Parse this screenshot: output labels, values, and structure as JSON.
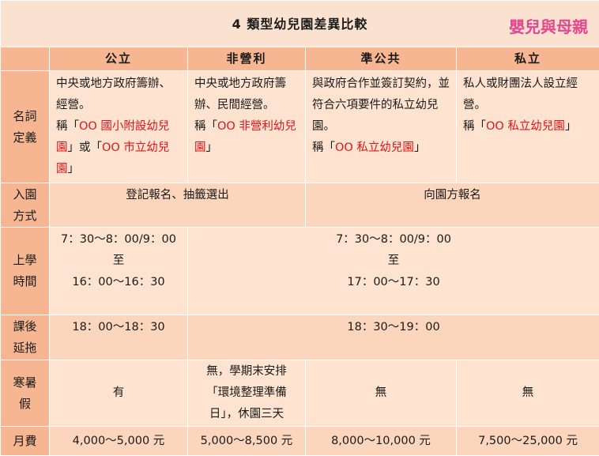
{
  "title": "4 類型幼兒園差異比較",
  "logo_text": "嬰兒與母親",
  "columns": [
    "公立",
    "非營利",
    "準公共",
    "私立"
  ],
  "definition": {
    "label_lines": [
      "名詞",
      "定義"
    ],
    "public": {
      "text": "中央或地方政府籌辦、經營。",
      "prefix": "稱「",
      "red1": "OO 國小附設幼兒園",
      "mid": "」或「",
      "red2": "OO 市立幼兒園",
      "suffix": "」"
    },
    "nonprofit": {
      "text": "中央或地方政府籌辦、民間經營。",
      "prefix": "稱「",
      "red": "OO 非營利幼兒園",
      "suffix": "」"
    },
    "quasi_public": {
      "text": "與政府合作並簽訂契約，並符合六項要件的私立幼兒園。",
      "prefix": "稱「",
      "red": "OO 私立幼兒園",
      "suffix": "」"
    },
    "private": {
      "text": "私人或財團法人設立經營。",
      "prefix": "稱「",
      "red": "OO 私立幼兒園",
      "suffix": "」"
    }
  },
  "enrollment": {
    "label_lines": [
      "入園",
      "方式"
    ],
    "left": "登記報名、抽籤選出",
    "right": "向園方報名"
  },
  "school_hours": {
    "label_lines": [
      "上學",
      "時間"
    ],
    "public_lines": [
      "7：30～8：00/9：00",
      "至",
      "16：00～16：30"
    ],
    "others_lines": [
      "7：30～8：00/9：00",
      "至",
      "17：00～17：30"
    ]
  },
  "after_care": {
    "label_lines": [
      "課後",
      "延拖"
    ],
    "public": "18：00～18：30",
    "others": "18：30～19：00"
  },
  "vacation": {
    "label_lines": [
      "寒暑",
      "假"
    ],
    "public": "有",
    "nonprofit_lines": [
      "無，學期末安排",
      "「環境整理準備",
      "日」，休園三天"
    ],
    "quasi_public": "無",
    "private": "無"
  },
  "monthly_fee": {
    "label": "月費",
    "public": "4,000～5,000 元",
    "nonprofit": "5,000～8,500 元",
    "quasi_public": "8,000～10,000 元",
    "private": "7,500～25,000 元"
  }
}
